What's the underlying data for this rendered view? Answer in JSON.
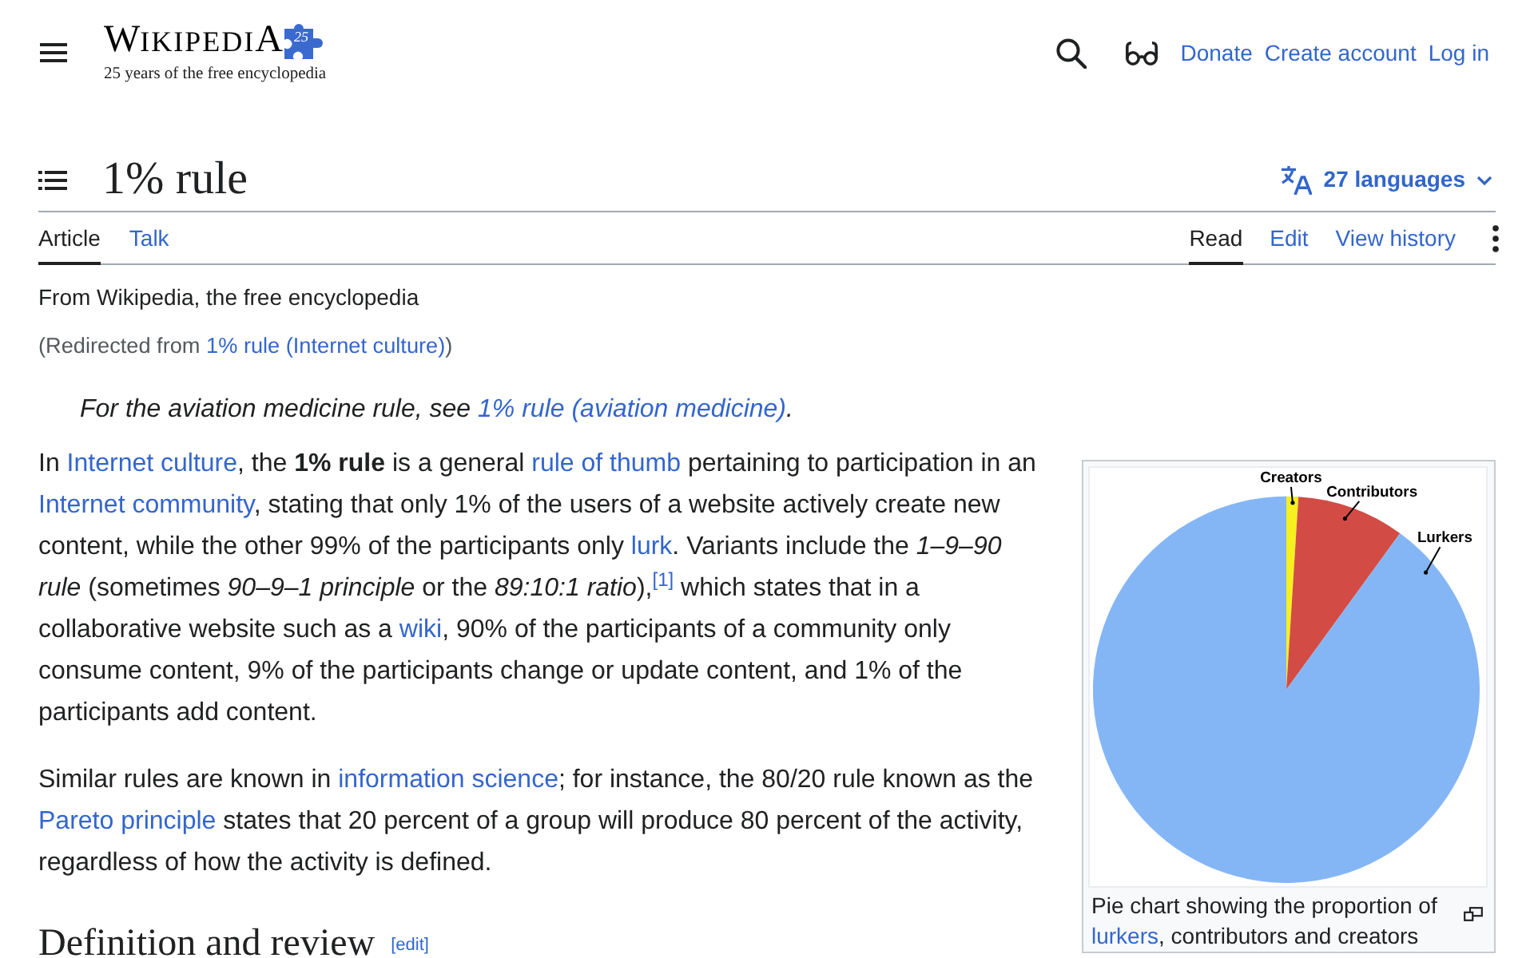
{
  "header": {
    "logo": {
      "wordmark": "WIKIPEDIA",
      "badge": "25",
      "tagline": "25 years of the free encyclopedia"
    },
    "links": [
      "Donate",
      "Create account",
      "Log in"
    ]
  },
  "title": "1% rule",
  "languages": "27 languages",
  "namespace_tabs": [
    {
      "label": "Article",
      "selected": true
    },
    {
      "label": "Talk",
      "selected": false
    }
  ],
  "view_tabs": [
    {
      "label": "Read",
      "selected": true
    },
    {
      "label": "Edit",
      "selected": false
    },
    {
      "label": "View history",
      "selected": false
    }
  ],
  "tagline": "From Wikipedia, the free encyclopedia",
  "redirect": [
    {
      "kind": "text",
      "text": "(Redirected from "
    },
    {
      "kind": "link",
      "text": "1% rule (Internet culture)"
    },
    {
      "kind": "text",
      "text": ")"
    }
  ],
  "hatnote": [
    {
      "kind": "text",
      "text": "For the aviation medicine rule, see "
    },
    {
      "kind": "link",
      "text": "1% rule (aviation medicine)"
    },
    {
      "kind": "text",
      "text": "."
    }
  ],
  "paragraphs": [
    [
      {
        "kind": "text",
        "text": "In "
      },
      {
        "kind": "link",
        "text": "Internet culture"
      },
      {
        "kind": "text",
        "text": ", the **1% rule** is a general "
      },
      {
        "kind": "link",
        "text": "rule of thumb"
      },
      {
        "kind": "text",
        "text": " pertaining to participation in an "
      },
      {
        "kind": "link",
        "text": "Internet community"
      },
      {
        "kind": "text",
        "text": ", stating that only 1% of the users of a website actively create new content, while the other 99% of the participants only "
      },
      {
        "kind": "link",
        "text": "lurk"
      },
      {
        "kind": "text",
        "text": ". Variants include the *1–9–90 rule* (sometimes *90–9–1 principle* or the *89:10:1 ratio*),"
      },
      {
        "kind": "ref",
        "text": "[1]"
      },
      {
        "kind": "text",
        "text": " which states that in a collaborative website such as a "
      },
      {
        "kind": "link",
        "text": "wiki"
      },
      {
        "kind": "text",
        "text": ", 90% of the participants of a community only consume content, 9% of the participants change or update content, and 1% of the participants add content."
      }
    ],
    [
      {
        "kind": "text",
        "text": "Similar rules are known in "
      },
      {
        "kind": "link",
        "text": "information science"
      },
      {
        "kind": "text",
        "text": "; for instance, the 80/20 rule known as the "
      },
      {
        "kind": "link",
        "text": "Pareto principle"
      },
      {
        "kind": "text",
        "text": " states that 20 percent of a group will produce 80 percent of the activity, regardless of how the activity is defined."
      }
    ]
  ],
  "figure": {
    "slices": [
      {
        "label": "Creators",
        "color": "#f5f01e"
      },
      {
        "label": "Contributors",
        "color": "#d34b45"
      },
      {
        "label": "Lurkers",
        "color": "#84b6f6"
      }
    ],
    "caption": [
      {
        "kind": "text",
        "text": "Pie chart showing the proportion of "
      },
      {
        "kind": "link",
        "text": "lurkers"
      },
      {
        "kind": "text",
        "text": ", contributors and creators"
      }
    ]
  },
  "section": {
    "title": "Definition and review",
    "edit_link": "[edit]"
  }
}
